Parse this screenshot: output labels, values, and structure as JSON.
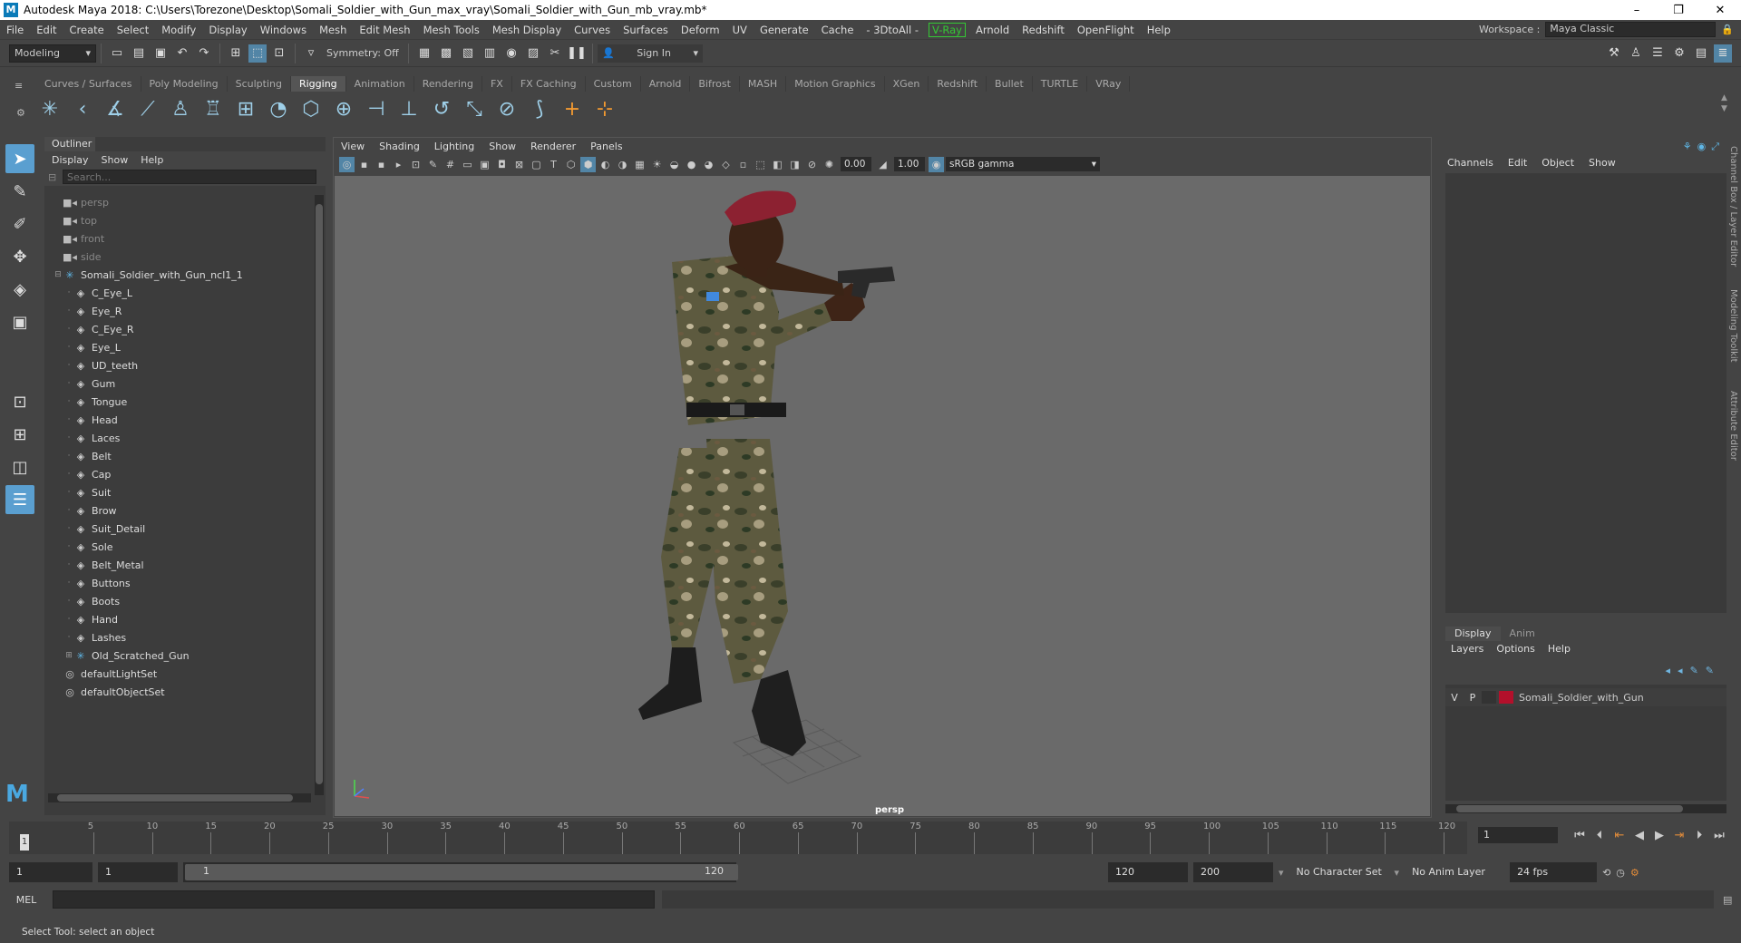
{
  "title": "Autodesk Maya 2018: C:\\Users\\Torezone\\Desktop\\Somali_Soldier_with_Gun_max_vray\\Somali_Soldier_with_Gun_mb_vray.mb*",
  "menu": [
    "File",
    "Edit",
    "Create",
    "Select",
    "Modify",
    "Display",
    "Windows",
    "Mesh",
    "Edit Mesh",
    "Mesh Tools",
    "Mesh Display",
    "Curves",
    "Surfaces",
    "Deform",
    "UV",
    "Generate",
    "Cache",
    "- 3DtoAll -",
    "V-Ray",
    "Arnold",
    "Redshift",
    "OpenFlight",
    "Help"
  ],
  "workspace": {
    "label": "Workspace :",
    "value": "Maya Classic"
  },
  "status": {
    "mode": "Modeling",
    "symmetry": "Symmetry: Off",
    "sign_in": "Sign In"
  },
  "shelf_tabs": [
    "Curves / Surfaces",
    "Poly Modeling",
    "Sculpting",
    "Rigging",
    "Animation",
    "Rendering",
    "FX",
    "FX Caching",
    "Custom",
    "Arnold",
    "Bifrost",
    "MASH",
    "Motion Graphics",
    "XGen",
    "Redshift",
    "Bullet",
    "TURTLE",
    "VRay"
  ],
  "active_shelf_tab": "Rigging",
  "outliner": {
    "tab": "Outliner",
    "menu": [
      "Display",
      "Show",
      "Help"
    ],
    "search_placeholder": "Search...",
    "items": [
      {
        "label": "persp",
        "type": "camera",
        "dim": true
      },
      {
        "label": "top",
        "type": "camera",
        "dim": true
      },
      {
        "label": "front",
        "type": "camera",
        "dim": true
      },
      {
        "label": "side",
        "type": "camera",
        "dim": true
      },
      {
        "label": "Somali_Soldier_with_Gun_ncl1_1",
        "type": "joint",
        "expand": "minus"
      },
      {
        "label": "C_Eye_L",
        "type": "mesh",
        "indent": 1
      },
      {
        "label": "Eye_R",
        "type": "mesh",
        "indent": 1
      },
      {
        "label": "C_Eye_R",
        "type": "mesh",
        "indent": 1
      },
      {
        "label": "Eye_L",
        "type": "mesh",
        "indent": 1
      },
      {
        "label": "UD_teeth",
        "type": "mesh",
        "indent": 1
      },
      {
        "label": "Gum",
        "type": "mesh",
        "indent": 1
      },
      {
        "label": "Tongue",
        "type": "mesh",
        "indent": 1
      },
      {
        "label": "Head",
        "type": "mesh",
        "indent": 1
      },
      {
        "label": "Laces",
        "type": "mesh",
        "indent": 1
      },
      {
        "label": "Belt",
        "type": "mesh",
        "indent": 1
      },
      {
        "label": "Cap",
        "type": "mesh",
        "indent": 1
      },
      {
        "label": "Suit",
        "type": "mesh",
        "indent": 1
      },
      {
        "label": "Brow",
        "type": "mesh",
        "indent": 1
      },
      {
        "label": "Suit_Detail",
        "type": "mesh",
        "indent": 1
      },
      {
        "label": "Sole",
        "type": "mesh",
        "indent": 1
      },
      {
        "label": "Belt_Metal",
        "type": "mesh",
        "indent": 1
      },
      {
        "label": "Buttons",
        "type": "mesh",
        "indent": 1
      },
      {
        "label": "Boots",
        "type": "mesh",
        "indent": 1
      },
      {
        "label": "Hand",
        "type": "mesh",
        "indent": 1
      },
      {
        "label": "Lashes",
        "type": "mesh",
        "indent": 1
      },
      {
        "label": "Old_Scratched_Gun",
        "type": "joint",
        "indent": 1,
        "expand": "plus"
      },
      {
        "label": "defaultLightSet",
        "type": "set"
      },
      {
        "label": "defaultObjectSet",
        "type": "set"
      }
    ]
  },
  "viewport": {
    "menu": [
      "View",
      "Shading",
      "Lighting",
      "Show",
      "Renderer",
      "Panels"
    ],
    "near": "0.00",
    "far": "1.00",
    "color_space": "sRGB gamma",
    "camera_label": "persp"
  },
  "channel_box": {
    "menu": [
      "Channels",
      "Edit",
      "Object",
      "Show"
    ],
    "layer_tabs": [
      "Display",
      "Anim"
    ],
    "layer_menu": [
      "Layers",
      "Options",
      "Help"
    ],
    "layer": {
      "v": "V",
      "p": "P",
      "name": "Somali_Soldier_with_Gun",
      "color": "#b3102b"
    },
    "side_labels": [
      "Channel Box / Layer Editor",
      "Modeling Toolkit",
      "Attribute Editor"
    ]
  },
  "timeline": {
    "ticks": [
      "5",
      "10",
      "15",
      "20",
      "25",
      "30",
      "35",
      "40",
      "45",
      "50",
      "55",
      "60",
      "65",
      "70",
      "75",
      "80",
      "85",
      "90",
      "95",
      "100",
      "105",
      "110",
      "115",
      "120"
    ],
    "current": "1",
    "current_frame_field": "1"
  },
  "range": {
    "start": "1",
    "anim_start": "1",
    "slider_start": "1",
    "slider_end": "120",
    "end": "120",
    "anim_end": "200",
    "character_set": "No Character Set",
    "anim_layer": "No Anim Layer",
    "fps": "24 fps"
  },
  "command": {
    "label": "MEL"
  },
  "help_line": "Select Tool: select an object",
  "colors": {
    "accent": "#5285a6",
    "active_tool": "#5a9fd0",
    "vray": "#34c934",
    "layer": "#b3102b"
  }
}
